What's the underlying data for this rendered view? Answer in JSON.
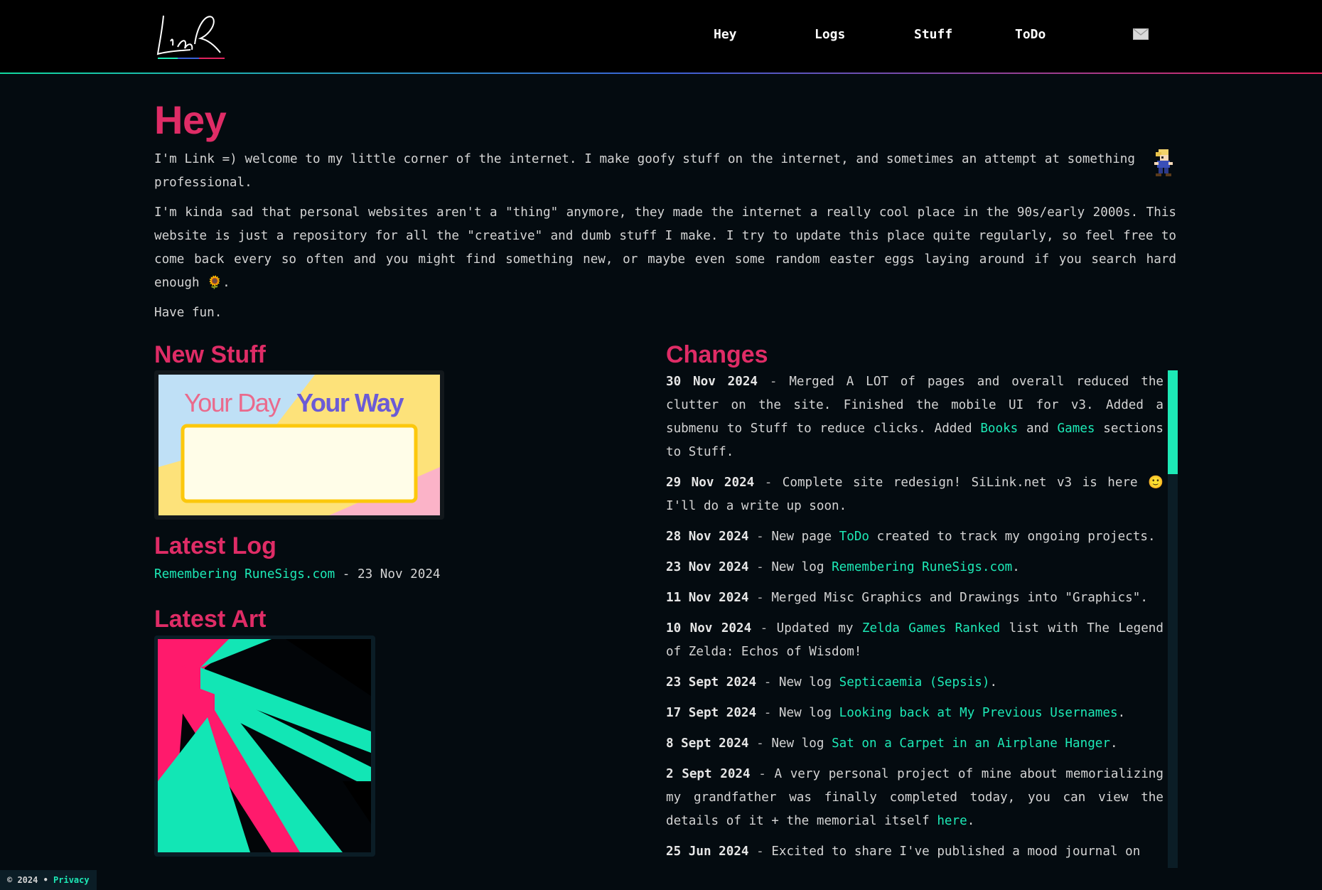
{
  "header": {
    "logo_text": "Link",
    "nav": [
      {
        "label": "Hey"
      },
      {
        "label": "Logs"
      },
      {
        "label": "Stuff"
      },
      {
        "label": "ToDo"
      }
    ],
    "mail_icon": "envelope-icon"
  },
  "hey": {
    "title": "Hey",
    "p1": "I'm Link =) welcome to my little corner of the internet. I make goofy stuff on the internet, and sometimes an attempt at something professional.",
    "p2": "I'm kinda sad that personal websites aren't a \"thing\" anymore, they made the internet a really cool place in the 90s/early 2000s. This website is just a repository for all the \"creative\" and dumb stuff I make. I try to update this place quite regularly, so feel free to come back every so often and you might find something new, or maybe even some random easter eggs laying around if you search hard enough",
    "p2_emoji": "🌻",
    "p2_end": ".",
    "p3": "Have fun."
  },
  "new_stuff": {
    "title": "New Stuff",
    "image_text_a": "Your Day",
    "image_text_b": "Your Way"
  },
  "latest_log": {
    "title": "Latest Log",
    "link": "Remembering RuneSigs.com",
    "sep": " - ",
    "date": "23 Nov 2024"
  },
  "latest_art": {
    "title": "Latest Art"
  },
  "changes": {
    "title": "Changes",
    "entries": [
      {
        "date": "30 Nov 2024",
        "t1": "Merged A LOT of pages and overall reduced the clutter on the site. Finished the mobile UI for v3. Added a submenu to Stuff to reduce clicks. Added ",
        "l1": "Books",
        "t2": " and ",
        "l2": "Games",
        "t3": " sections to Stuff."
      },
      {
        "date": "29 Nov 2024",
        "t1": "Complete site redesign! SiLink.net v3 is here 🙂 I'll do a write up soon.",
        "l1": "",
        "t2": "",
        "l2": "",
        "t3": ""
      },
      {
        "date": "28 Nov 2024",
        "t1": "New page ",
        "l1": "ToDo",
        "t2": " created to track my ongoing projects.",
        "l2": "",
        "t3": ""
      },
      {
        "date": "23 Nov 2024",
        "t1": "New log ",
        "l1": "Remembering RuneSigs.com",
        "t2": ".",
        "l2": "",
        "t3": ""
      },
      {
        "date": "11 Nov 2024",
        "t1": "Merged Misc Graphics and Drawings into \"Graphics\".",
        "l1": "",
        "t2": "",
        "l2": "",
        "t3": ""
      },
      {
        "date": "10 Nov 2024",
        "t1": "Updated my ",
        "l1": "Zelda Games Ranked",
        "t2": " list with The Legend of Zelda: Echos of Wisdom!",
        "l2": "",
        "t3": ""
      },
      {
        "date": "23 Sept 2024",
        "t1": "New log ",
        "l1": "Septicaemia (Sepsis)",
        "t2": ".",
        "l2": "",
        "t3": ""
      },
      {
        "date": "17 Sept 2024",
        "t1": "New log ",
        "l1": "Looking back at My Previous Usernames",
        "t2": ".",
        "l2": "",
        "t3": ""
      },
      {
        "date": "8 Sept 2024",
        "t1": "New log ",
        "l1": "Sat on a Carpet in an Airplane Hanger",
        "t2": ".",
        "l2": "",
        "t3": ""
      },
      {
        "date": "2 Sept 2024",
        "t1": "A very personal project of mine about memorializing my grandfather was finally completed today, you can view the details of it + the memorial itself ",
        "l1": "here",
        "t2": ".",
        "l2": "",
        "t3": ""
      },
      {
        "date": "25 Jun 2024",
        "t1": "Excited to share I've published a mood journal on",
        "l1": "",
        "t2": "",
        "l2": "",
        "t3": ""
      }
    ]
  },
  "footer": {
    "copyright": "© 2024 •",
    "privacy": "Privacy"
  },
  "colors": {
    "accent_pink": "#df2c66",
    "link_teal": "#1de9b6",
    "background": "#040b10"
  }
}
